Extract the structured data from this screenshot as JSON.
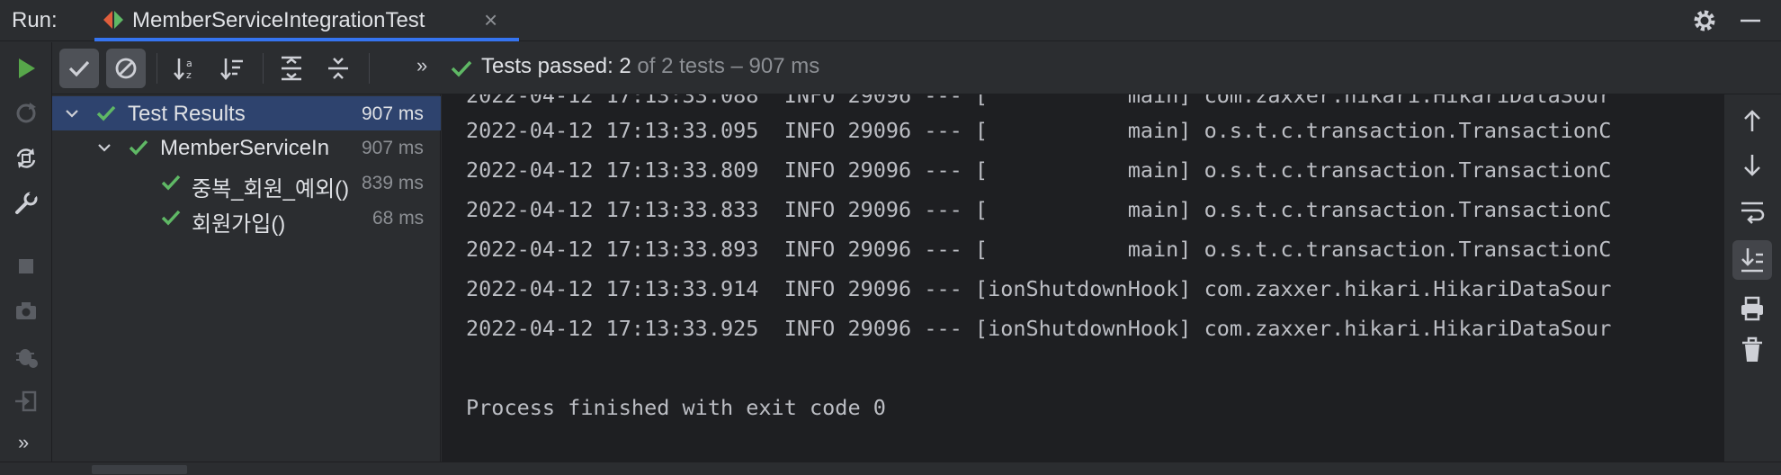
{
  "topbar": {
    "run_label": "Run:",
    "tab_title": "MemberServiceIntegrationTest",
    "tab_close": "×",
    "icons": [
      "settings-icon",
      "minimize-icon"
    ]
  },
  "left_toolbar": {
    "icons": [
      "run-icon",
      "rerun-failed-icon",
      "toggle-auto-test-icon",
      "settings-wrench-icon",
      "stop-icon",
      "screenshot-icon",
      "debug-icon",
      "exit-icon"
    ],
    "more": "»"
  },
  "test_toolbar": {
    "buttons": [
      "show-passed",
      "show-ignored",
      "sort-alphabetically",
      "sort-by-duration",
      "expand-all",
      "collapse-all"
    ],
    "more": "»",
    "status_main": "Tests passed: 2",
    "status_sub": " of 2 tests – 907 ms"
  },
  "tree": {
    "rows": [
      {
        "label": "Test Results",
        "time": "907 ms",
        "selected": true,
        "level": 0
      },
      {
        "label": "MemberServiceIn",
        "time": "907 ms",
        "selected": false,
        "level": 1
      },
      {
        "label": "중복_회원_예외()",
        "time": "839 ms",
        "selected": false,
        "level": 2
      },
      {
        "label": "회원가입()",
        "time": "68 ms",
        "selected": false,
        "level": 2
      }
    ]
  },
  "console": {
    "partial_top": "2022-04-12 17:13:33.088  INFO 29096 --- [           main] com.zaxxer.hikari.HikariDataSour",
    "lines": [
      "2022-04-12 17:13:33.095  INFO 29096 --- [           main] o.s.t.c.transaction.TransactionC",
      "2022-04-12 17:13:33.809  INFO 29096 --- [           main] o.s.t.c.transaction.TransactionC",
      "2022-04-12 17:13:33.833  INFO 29096 --- [           main] o.s.t.c.transaction.TransactionC",
      "2022-04-12 17:13:33.893  INFO 29096 --- [           main] o.s.t.c.transaction.TransactionC",
      "2022-04-12 17:13:33.914  INFO 29096 --- [ionShutdownHook] com.zaxxer.hikari.HikariDataSour",
      "2022-04-12 17:13:33.925  INFO 29096 --- [ionShutdownHook] com.zaxxer.hikari.HikariDataSour"
    ],
    "exit_message": "Process finished with exit code 0"
  },
  "right_toolbar": {
    "icons": [
      "scroll-up-icon",
      "scroll-down-icon",
      "soft-wrap-icon",
      "scroll-to-end-icon",
      "print-icon",
      "trash-icon"
    ]
  },
  "colors": {
    "green_check": "#5fb865",
    "run_green": "#57a64a",
    "selection": "#2e436e",
    "accent_blue": "#3574f0"
  }
}
